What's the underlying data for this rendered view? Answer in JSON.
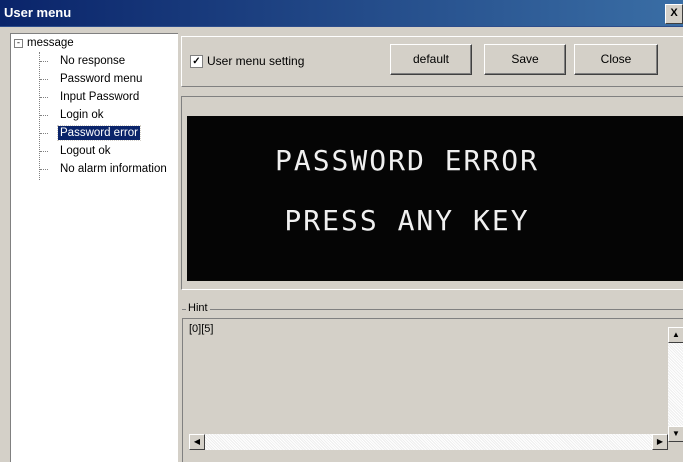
{
  "window": {
    "title": "User menu",
    "close_glyph": "X"
  },
  "tree": {
    "root": {
      "label": "message",
      "expander": "-"
    },
    "items": [
      {
        "label": "No response"
      },
      {
        "label": "Password menu"
      },
      {
        "label": "Input Password"
      },
      {
        "label": "Login ok"
      },
      {
        "label": "Password error",
        "selected": true
      },
      {
        "label": "Logout ok"
      },
      {
        "label": "No alarm information"
      }
    ]
  },
  "toolbar": {
    "checkbox_label": "User menu setting",
    "checkbox_checked": true,
    "checkbox_mark": "✓",
    "default_label": "default",
    "save_label": "Save",
    "close_label": "Close"
  },
  "display": {
    "line1": "PASSWORD ERROR",
    "line2": "PRESS ANY KEY",
    "bg_color": "#050505",
    "fg_color": "#f0f0f0"
  },
  "hint": {
    "legend": "Hint",
    "text": "[0][5]"
  },
  "scrollbar": {
    "up": "▲",
    "down": "▼",
    "left": "◀",
    "right": "▶"
  }
}
